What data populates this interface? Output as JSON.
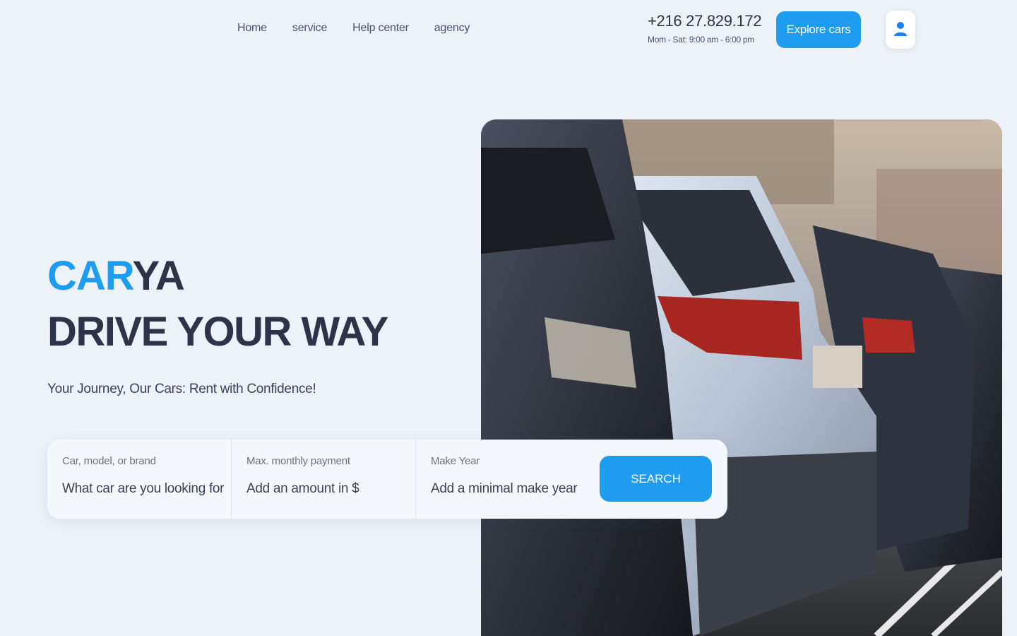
{
  "nav": {
    "links": [
      "Home",
      "service",
      "Help center",
      "agency"
    ]
  },
  "contact": {
    "phone": "+216 27.829.172",
    "hours": "Mom - Sat: 9:00 am - 6:00 pm"
  },
  "header": {
    "explore_label": "Explore cars",
    "user_icon": "user-icon"
  },
  "hero": {
    "brand_accent": "CAR",
    "brand_rest": "YA",
    "tagline": "DRIVE YOUR WAY",
    "subtitle": "Your Journey, Our Cars: Rent with Confidence!"
  },
  "search": {
    "fields": [
      {
        "label": "Car, model, or brand",
        "placeholder": "What car are you looking for?"
      },
      {
        "label": "Max. monthly payment",
        "placeholder": "Add an amount in $"
      },
      {
        "label": "Make Year",
        "placeholder": "Add a minimal make year"
      }
    ],
    "button_label": "SEARCH"
  },
  "colors": {
    "accent": "#1e9cf0",
    "background": "#edf1f8",
    "text": "#2f3347"
  }
}
